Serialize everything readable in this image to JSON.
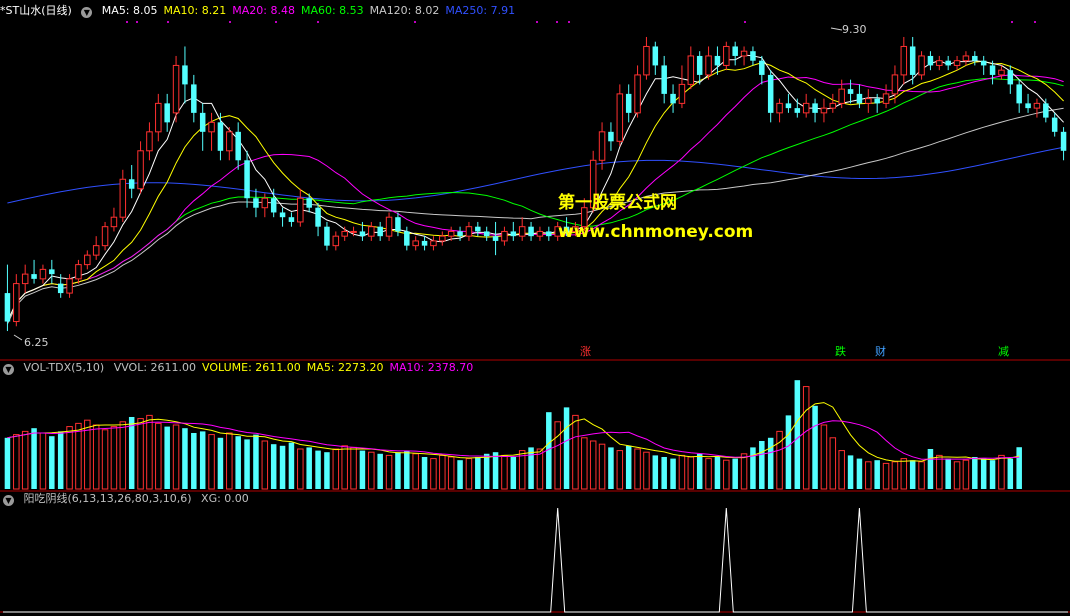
{
  "main_legend": {
    "title": "*ST山水(日线)",
    "items": [
      {
        "label": "MA5: 8.05",
        "color": "#ffffff"
      },
      {
        "label": "MA10: 8.21",
        "color": "#ffff00"
      },
      {
        "label": "MA20: 8.48",
        "color": "#ff00ff"
      },
      {
        "label": "MA60: 8.53",
        "color": "#00ff00"
      },
      {
        "label": "MA120: 8.02",
        "color": "#c8c8c8"
      },
      {
        "label": "MA250: 7.91",
        "color": "#3050ff"
      }
    ]
  },
  "price_labels": {
    "high": "9.30",
    "low": "6.25"
  },
  "watermark": {
    "line1": "第一股票公式网",
    "line2": "www.chnmoney.com"
  },
  "events": [
    {
      "label": "涨",
      "color": "#ff3030"
    },
    {
      "label": "跌",
      "color": "#00ff00"
    },
    {
      "label": "财",
      "color": "#40a0ff"
    },
    {
      "label": "减",
      "color": "#00ff00"
    }
  ],
  "vol_legend": {
    "title": "VOL-TDX(5,10)",
    "items": [
      {
        "label": "VVOL: 2611.00",
        "color": "#c0c0c0"
      },
      {
        "label": "VOLUME: 2611.00",
        "color": "#ffff00"
      },
      {
        "label": "MA5: 2273.20",
        "color": "#ffff00"
      },
      {
        "label": "MA10: 2378.70",
        "color": "#ff00ff"
      }
    ]
  },
  "ind_legend": {
    "title": "阳吃阴线(6,13,13,26,80,3,10,6)",
    "items": [
      {
        "label": "XG: 0.00",
        "color": "#c0c0c0"
      }
    ]
  },
  "chart_data": [
    {
      "type": "candlestick",
      "title": "*ST山水(日线)",
      "ylim": [
        6.0,
        9.5
      ],
      "annotations": {
        "max": 9.3,
        "min": 6.25
      },
      "colors": {
        "up": "#ff3030",
        "down": "#54ffff",
        "ma5": "#ffffff",
        "ma10": "#ffff00",
        "ma20": "#ff00ff",
        "ma60": "#00ff00",
        "ma120": "#c8c8c8",
        "ma250": "#3050ff"
      },
      "candles": [
        [
          6.6,
          6.3,
          6.9,
          6.2
        ],
        [
          6.3,
          6.7,
          6.8,
          6.25
        ],
        [
          6.7,
          6.8,
          6.9,
          6.6
        ],
        [
          6.8,
          6.75,
          6.95,
          6.7
        ],
        [
          6.75,
          6.85,
          6.9,
          6.7
        ],
        [
          6.85,
          6.8,
          6.95,
          6.7
        ],
        [
          6.7,
          6.6,
          6.8,
          6.55
        ],
        [
          6.6,
          6.75,
          6.8,
          6.55
        ],
        [
          6.75,
          6.9,
          6.95,
          6.7
        ],
        [
          6.9,
          7.0,
          7.05,
          6.85
        ],
        [
          7.0,
          7.1,
          7.2,
          6.95
        ],
        [
          7.1,
          7.3,
          7.35,
          7.05
        ],
        [
          7.3,
          7.4,
          7.5,
          7.25
        ],
        [
          7.4,
          7.8,
          7.9,
          7.35
        ],
        [
          7.8,
          7.7,
          7.95,
          7.6
        ],
        [
          7.7,
          8.1,
          8.2,
          7.65
        ],
        [
          8.1,
          8.3,
          8.4,
          8.0
        ],
        [
          8.3,
          8.6,
          8.7,
          8.2
        ],
        [
          8.6,
          8.4,
          8.7,
          8.3
        ],
        [
          8.5,
          9.0,
          9.1,
          8.4
        ],
        [
          9.0,
          8.8,
          9.2,
          8.6
        ],
        [
          8.8,
          8.5,
          8.9,
          8.4
        ],
        [
          8.5,
          8.3,
          8.6,
          8.1
        ],
        [
          8.3,
          8.4,
          8.5,
          8.1
        ],
        [
          8.4,
          8.1,
          8.5,
          8.0
        ],
        [
          8.1,
          8.3,
          8.35,
          8.0
        ],
        [
          8.3,
          8.0,
          8.4,
          7.9
        ],
        [
          8.0,
          7.6,
          8.1,
          7.5
        ],
        [
          7.6,
          7.5,
          7.7,
          7.4
        ],
        [
          7.5,
          7.6,
          7.65,
          7.4
        ],
        [
          7.6,
          7.45,
          7.7,
          7.4
        ],
        [
          7.45,
          7.4,
          7.5,
          7.3
        ],
        [
          7.4,
          7.35,
          7.45,
          7.3
        ],
        [
          7.35,
          7.6,
          7.7,
          7.3
        ],
        [
          7.6,
          7.5,
          7.65,
          7.45
        ],
        [
          7.5,
          7.3,
          7.55,
          7.2
        ],
        [
          7.3,
          7.1,
          7.35,
          7.05
        ],
        [
          7.1,
          7.2,
          7.25,
          7.05
        ],
        [
          7.2,
          7.25,
          7.3,
          7.15
        ],
        [
          7.25,
          7.25,
          7.3,
          7.2
        ],
        [
          7.25,
          7.2,
          7.35,
          7.15
        ],
        [
          7.2,
          7.3,
          7.35,
          7.15
        ],
        [
          7.3,
          7.2,
          7.35,
          7.15
        ],
        [
          7.2,
          7.4,
          7.45,
          7.15
        ],
        [
          7.4,
          7.25,
          7.45,
          7.2
        ],
        [
          7.25,
          7.1,
          7.3,
          7.05
        ],
        [
          7.1,
          7.15,
          7.2,
          7.05
        ],
        [
          7.15,
          7.1,
          7.2,
          7.05
        ],
        [
          7.1,
          7.15,
          7.2,
          7.05
        ],
        [
          7.15,
          7.2,
          7.25,
          7.1
        ],
        [
          7.2,
          7.25,
          7.3,
          7.15
        ],
        [
          7.25,
          7.2,
          7.3,
          7.15
        ],
        [
          7.2,
          7.3,
          7.35,
          7.15
        ],
        [
          7.3,
          7.25,
          7.35,
          7.2
        ],
        [
          7.25,
          7.2,
          7.3,
          7.15
        ],
        [
          7.2,
          7.15,
          7.35,
          7.0
        ],
        [
          7.15,
          7.25,
          7.3,
          7.1
        ],
        [
          7.25,
          7.2,
          7.35,
          7.15
        ],
        [
          7.2,
          7.3,
          7.4,
          7.15
        ],
        [
          7.3,
          7.2,
          7.35,
          7.15
        ],
        [
          7.2,
          7.25,
          7.3,
          7.15
        ],
        [
          7.25,
          7.2,
          7.3,
          7.15
        ],
        [
          7.2,
          7.3,
          7.35,
          7.15
        ],
        [
          7.3,
          7.25,
          7.4,
          7.2
        ],
        [
          7.25,
          7.3,
          7.35,
          7.2
        ],
        [
          7.3,
          7.5,
          7.6,
          7.25
        ],
        [
          7.5,
          8.0,
          8.1,
          7.45
        ],
        [
          8.0,
          8.3,
          8.4,
          7.9
        ],
        [
          8.3,
          8.2,
          8.4,
          8.1
        ],
        [
          8.2,
          8.7,
          8.8,
          8.15
        ],
        [
          8.7,
          8.5,
          8.8,
          8.4
        ],
        [
          8.5,
          8.9,
          9.0,
          8.45
        ],
        [
          8.9,
          9.2,
          9.3,
          8.85
        ],
        [
          9.2,
          9.0,
          9.25,
          8.9
        ],
        [
          9.0,
          8.7,
          9.1,
          8.6
        ],
        [
          8.7,
          8.6,
          8.8,
          8.5
        ],
        [
          8.6,
          8.8,
          9.0,
          8.55
        ],
        [
          8.8,
          9.1,
          9.2,
          8.75
        ],
        [
          9.1,
          8.9,
          9.15,
          8.8
        ],
        [
          8.9,
          9.1,
          9.2,
          8.85
        ],
        [
          9.1,
          9.0,
          9.2,
          8.9
        ],
        [
          9.0,
          9.2,
          9.25,
          8.95
        ],
        [
          9.2,
          9.1,
          9.25,
          9.0
        ],
        [
          9.1,
          9.15,
          9.2,
          9.0
        ],
        [
          9.15,
          9.05,
          9.2,
          9.0
        ],
        [
          9.05,
          8.9,
          9.1,
          8.8
        ],
        [
          8.9,
          8.5,
          8.95,
          8.4
        ],
        [
          8.5,
          8.6,
          8.65,
          8.4
        ],
        [
          8.6,
          8.55,
          8.7,
          8.5
        ],
        [
          8.55,
          8.5,
          8.65,
          8.45
        ],
        [
          8.5,
          8.6,
          8.7,
          8.45
        ],
        [
          8.6,
          8.5,
          8.65,
          8.4
        ],
        [
          8.5,
          8.55,
          8.65,
          8.4
        ],
        [
          8.55,
          8.6,
          8.7,
          8.5
        ],
        [
          8.6,
          8.75,
          8.85,
          8.55
        ],
        [
          8.75,
          8.7,
          8.85,
          8.6
        ],
        [
          8.7,
          8.6,
          8.8,
          8.55
        ],
        [
          8.6,
          8.65,
          8.75,
          8.5
        ],
        [
          8.65,
          8.6,
          8.7,
          8.5
        ],
        [
          8.6,
          8.7,
          8.8,
          8.55
        ],
        [
          8.7,
          8.9,
          9.0,
          8.6
        ],
        [
          8.9,
          9.2,
          9.3,
          8.8
        ],
        [
          9.2,
          8.9,
          9.3,
          8.8
        ],
        [
          8.9,
          9.1,
          9.15,
          8.85
        ],
        [
          9.1,
          9.0,
          9.15,
          8.95
        ],
        [
          9.0,
          9.05,
          9.1,
          8.95
        ],
        [
          9.05,
          9.0,
          9.1,
          8.95
        ],
        [
          9.0,
          9.05,
          9.1,
          8.95
        ],
        [
          9.05,
          9.1,
          9.15,
          9.0
        ],
        [
          9.1,
          9.05,
          9.15,
          9.0
        ],
        [
          9.05,
          9.0,
          9.1,
          8.9
        ],
        [
          9.0,
          8.9,
          9.05,
          8.8
        ],
        [
          8.9,
          8.95,
          9.0,
          8.85
        ],
        [
          8.95,
          8.8,
          9.0,
          8.7
        ],
        [
          8.8,
          8.6,
          8.85,
          8.5
        ],
        [
          8.6,
          8.55,
          8.7,
          8.5
        ],
        [
          8.55,
          8.6,
          8.65,
          8.45
        ],
        [
          8.6,
          8.45,
          8.65,
          8.4
        ],
        [
          8.45,
          8.3,
          8.5,
          8.25
        ],
        [
          8.3,
          8.1,
          8.35,
          8.0
        ]
      ]
    },
    {
      "type": "bar",
      "title": "VOL-TDX(5,10)",
      "series": [
        {
          "name": "VOLUME",
          "values": [
            3200,
            3400,
            3600,
            3800,
            3500,
            3300,
            3600,
            3900,
            4100,
            4300,
            4000,
            3700,
            3900,
            4200,
            4500,
            4400,
            4600,
            4100,
            3900,
            4000,
            3800,
            3500,
            3600,
            3400,
            3200,
            3500,
            3300,
            3100,
            3400,
            3000,
            2800,
            2700,
            2900,
            2500,
            2600,
            2400,
            2300,
            2500,
            2700,
            2600,
            2400,
            2300,
            2200,
            2100,
            2300,
            2400,
            2200,
            2000,
            1900,
            2100,
            2000,
            1800,
            1900,
            2000,
            2200,
            2300,
            2100,
            2000,
            2400,
            2600,
            2500,
            4800,
            4200,
            5100,
            4600,
            3200,
            3000,
            2800,
            2600,
            2400,
            2700,
            2500,
            2300,
            2100,
            2000,
            1900,
            2100,
            2000,
            2200,
            1900,
            2000,
            1800,
            1900,
            2200,
            2600,
            3000,
            3200,
            3600,
            4600,
            6800,
            6400,
            5200,
            4000,
            3200,
            2400,
            2100,
            1900,
            1700,
            1800,
            1600,
            1700,
            1900,
            1800,
            1700,
            2500,
            2100,
            1900,
            1700,
            1800,
            2000,
            1900,
            1800,
            2100,
            1900,
            2611
          ]
        }
      ]
    },
    {
      "type": "line",
      "title": "阳吃阴线(6,13,13,26,80,3,10,6)",
      "series": [
        {
          "name": "XG",
          "values": [
            0,
            0,
            0,
            0,
            0,
            0,
            0,
            0,
            0,
            0,
            0,
            0,
            0,
            0,
            0,
            0,
            0,
            0,
            0,
            0,
            0,
            0,
            0,
            0,
            0,
            0,
            0,
            0,
            0,
            0,
            0,
            0,
            0,
            0,
            0,
            0,
            0,
            0,
            0,
            0,
            0,
            0,
            0,
            0,
            0,
            0,
            0,
            0,
            0,
            0,
            0,
            0,
            0,
            0,
            0,
            0,
            0,
            0,
            0,
            0,
            0,
            0,
            1,
            0,
            0,
            0,
            0,
            0,
            0,
            0,
            0,
            0,
            0,
            0,
            0,
            0,
            0,
            0,
            0,
            0,
            0,
            1,
            0,
            0,
            0,
            0,
            0,
            0,
            0,
            0,
            0,
            0,
            0,
            0,
            0,
            0,
            1,
            0,
            0,
            0,
            0,
            0,
            0,
            0,
            0,
            0,
            0,
            0,
            0,
            0,
            0,
            0,
            0,
            0,
            0,
            0
          ]
        }
      ]
    }
  ]
}
